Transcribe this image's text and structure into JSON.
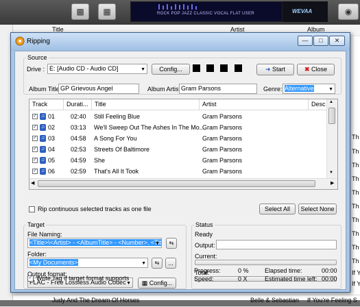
{
  "background": {
    "toolbar": {
      "eq_presets": "ROCK  POP  JAZZ  CLASSIC  VOCAL  FLAT  USER",
      "eq_logo": "WEVAA"
    },
    "list_headers": {
      "title": "Title",
      "artist": "Artist",
      "album": "Album"
    },
    "right_edge_snippets": [
      "Th",
      "Th",
      "Th",
      "Th",
      "Th",
      "Th",
      "Th",
      "Th",
      "Th",
      "Th",
      "Th",
      "Th",
      "Th",
      "If You're Feeling S",
      "If You're Feeling S",
      "If You're Feeling S"
    ],
    "bottom_row": {
      "title": "Judy And The Dream Of Horses",
      "artist": "Belle & Sebastian",
      "album": "If You're Feeling S"
    }
  },
  "dialog": {
    "title": "Ripping",
    "source": {
      "group_label": "Source",
      "drive_label": "Drive :",
      "drive_value": "E:  [Audio CD - Audio CD]",
      "config_label": "Config...",
      "start_label": "Start",
      "close_label": "Close",
      "album_title_label": "Album Title:",
      "album_title_value": "GP  Grievous Angel",
      "album_artist_label": "Album Artist:",
      "album_artist_value": "Gram Parsons",
      "genre_label": "Genre:",
      "genre_value": "Alternative"
    },
    "tracks": {
      "columns": [
        "Track",
        "Durati...",
        "Title",
        "Artist",
        "Desc"
      ],
      "rows": [
        {
          "track": "01",
          "duration": "02:40",
          "title": "Still Feeling Blue",
          "artist": "Gram Parsons"
        },
        {
          "track": "02",
          "duration": "03:13",
          "title": "We'll Sweep Out The Ashes In The Mo...",
          "artist": "Gram Parsons"
        },
        {
          "track": "03",
          "duration": "04:58",
          "title": "A Song For You",
          "artist": "Gram Parsons"
        },
        {
          "track": "04",
          "duration": "02:53",
          "title": "Streets Of Baltimore",
          "artist": "Gram Parsons"
        },
        {
          "track": "05",
          "duration": "04:59",
          "title": "She",
          "artist": "Gram Parsons"
        },
        {
          "track": "06",
          "duration": "02:59",
          "title": "That's All It Took",
          "artist": "Gram Parsons"
        }
      ]
    },
    "rip_continuous_label": "Rip continuous selected tracks as one file",
    "select_all_label": "Select All",
    "select_none_label": "Select None",
    "target": {
      "group_label": "Target",
      "file_naming_label": "File Naming:",
      "file_naming_value": "<Title>\\<Artist> - <AlbumTitle> - <Number>. <Title>",
      "folder_label": "Folder:",
      "folder_value": "<My Documents>",
      "output_format_label": "Output format:",
      "output_format_value": "FLAC - Free Lossless Audio Codec",
      "config_label": "Config...",
      "write_tag_label": "Write Tag if target format supports"
    },
    "status": {
      "group_label": "Status",
      "state": "Ready",
      "output_label": "Output:",
      "current_label": "Current:",
      "total_label": "Total:",
      "progress_label": "Progress:",
      "progress_value": "0 %",
      "speed_label": "Speed:",
      "speed_value": "0 X",
      "elapsed_label": "Elapsed time:",
      "elapsed_value": "00:00",
      "remaining_label": "Estimated time left:",
      "remaining_value": "00:00"
    }
  }
}
